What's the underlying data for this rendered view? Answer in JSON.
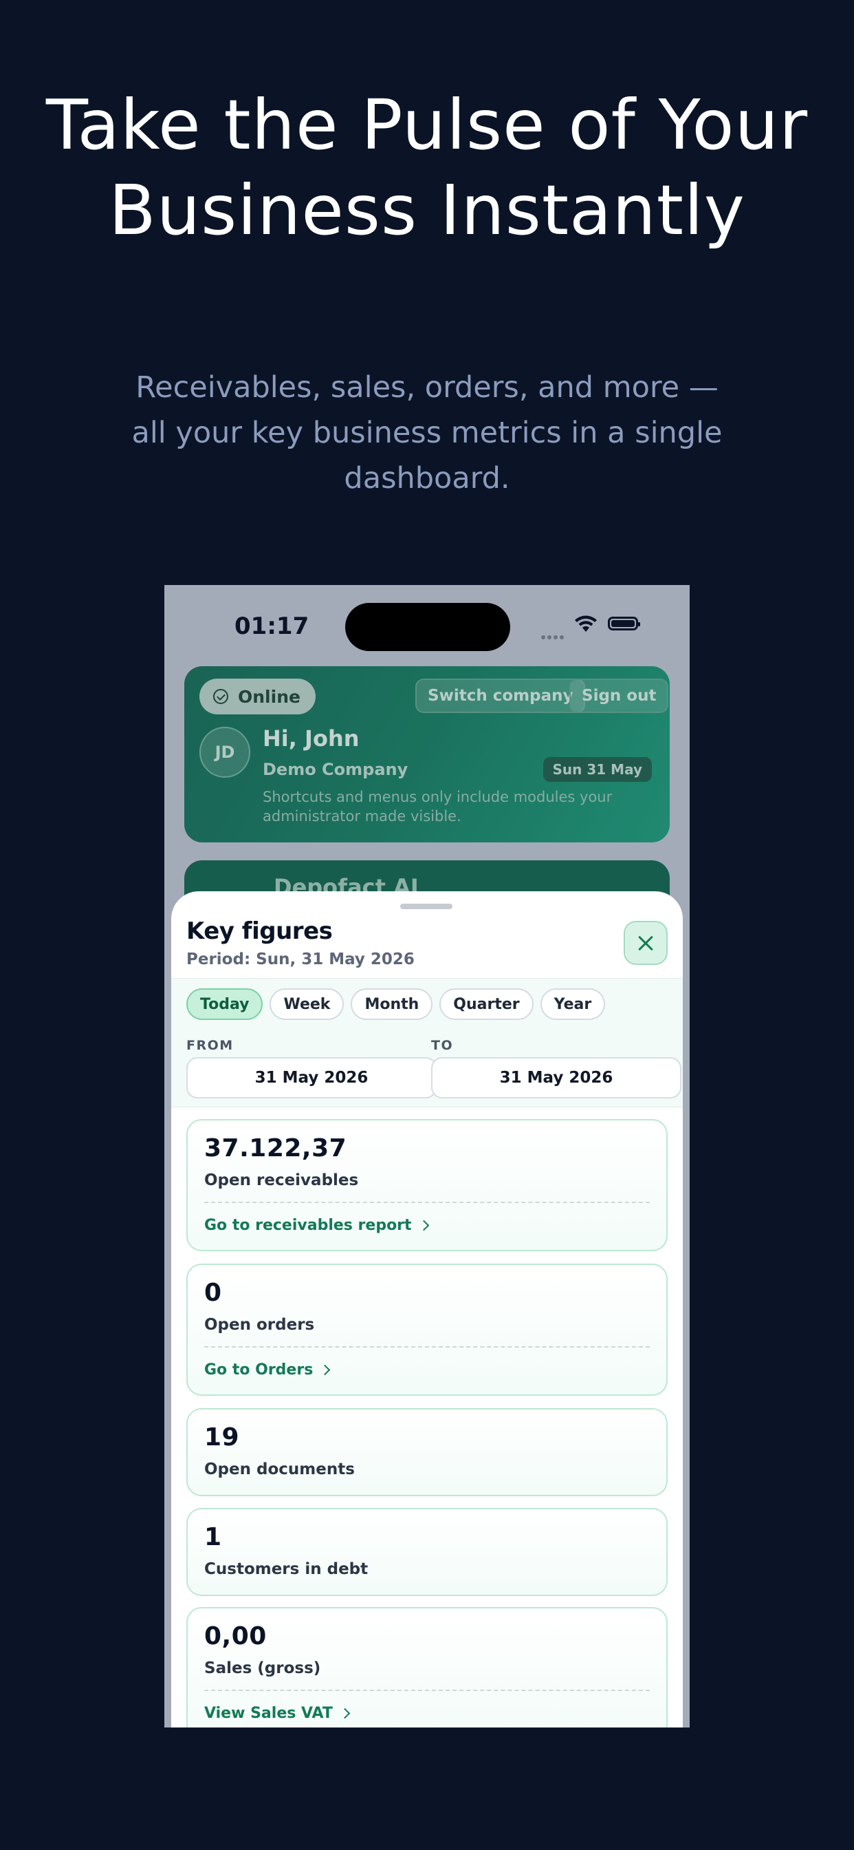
{
  "promo": {
    "title": "Take the Pulse of Your Business Instantly",
    "subtitle": "Receivables, sales, orders, and more — all your key business metrics in a single dashboard."
  },
  "status_bar": {
    "time": "01:17"
  },
  "welcome_card": {
    "online_label": "Online",
    "switch_company_label": "Switch company",
    "sign_out_label": "Sign out",
    "avatar_initials": "JD",
    "greeting": "Hi, John",
    "company": "Demo Company",
    "date_badge": "Sun 31 May",
    "note": "Shortcuts and menus only include modules your administrator made visible."
  },
  "ai_card": {
    "title": "Depofact AI"
  },
  "sheet": {
    "title": "Key figures",
    "period": "Period: Sun, 31 May 2026",
    "chips": [
      {
        "label": "Today",
        "active": true
      },
      {
        "label": "Week",
        "active": false
      },
      {
        "label": "Month",
        "active": false
      },
      {
        "label": "Quarter",
        "active": false
      },
      {
        "label": "Year",
        "active": false
      }
    ],
    "from_label": "FROM",
    "to_label": "TO",
    "from_value": "31 May 2026",
    "to_value": "31 May 2026",
    "metrics": [
      {
        "value": "37.122,37",
        "label": "Open receivables",
        "link": "Go to receivables report"
      },
      {
        "value": "0",
        "label": "Open orders",
        "link": "Go to Orders"
      },
      {
        "value": "19",
        "label": "Open documents"
      },
      {
        "value": "1",
        "label": "Customers in debt"
      },
      {
        "value": "0,00",
        "label": "Sales (gross)",
        "link": "View Sales VAT"
      }
    ]
  }
}
